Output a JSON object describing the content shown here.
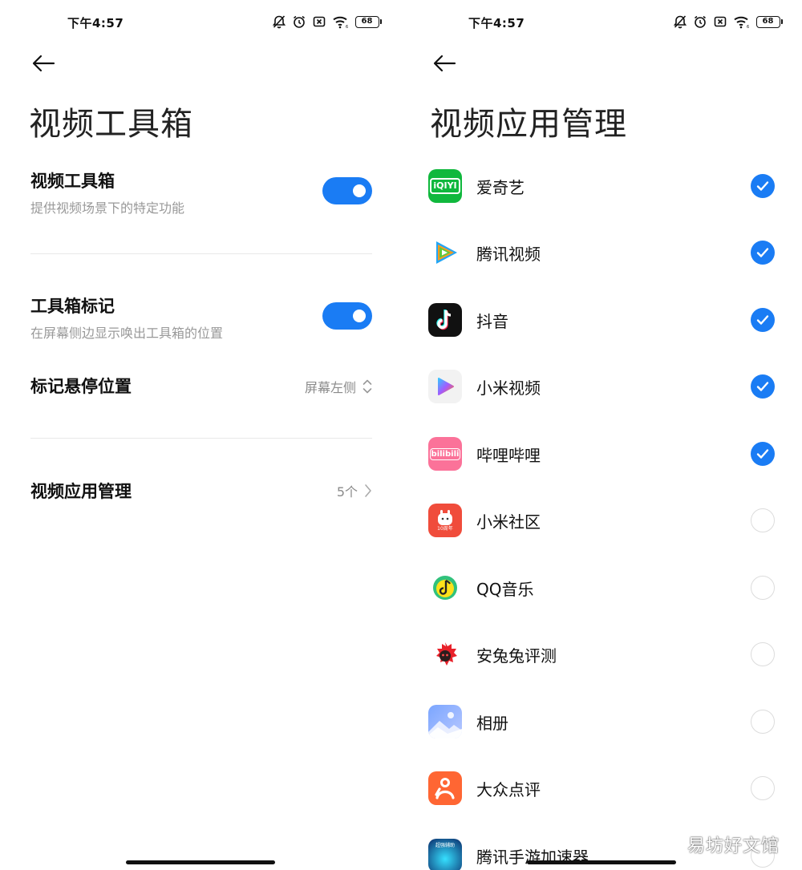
{
  "status_bar": {
    "time": "下午4:57",
    "battery": "68"
  },
  "left": {
    "title": "视频工具箱",
    "toolbox": {
      "title": "视频工具箱",
      "subtitle": "提供视频场景下的特定功能",
      "enabled": true
    },
    "marker": {
      "title": "工具箱标记",
      "subtitle": "在屏幕侧边显示唤出工具箱的位置",
      "enabled": true
    },
    "hover_position": {
      "title": "标记悬停位置",
      "value": "屏幕左侧"
    },
    "app_management": {
      "title": "视频应用管理",
      "value": "5个"
    }
  },
  "right": {
    "title": "视频应用管理",
    "apps": [
      {
        "name": "爱奇艺",
        "icon": "iqiyi-icon",
        "icon_text": "iQIYI",
        "checked": true
      },
      {
        "name": "腾讯视频",
        "icon": "tencent-video-icon",
        "checked": true
      },
      {
        "name": "抖音",
        "icon": "douyin-icon",
        "checked": true
      },
      {
        "name": "小米视频",
        "icon": "mi-video-icon",
        "checked": true
      },
      {
        "name": "哔哩哔哩",
        "icon": "bilibili-icon",
        "icon_text": "bilibili",
        "checked": true
      },
      {
        "name": "小米社区",
        "icon": "mi-community-icon",
        "icon_text": "10周年",
        "checked": false
      },
      {
        "name": "QQ音乐",
        "icon": "qq-music-icon",
        "checked": false
      },
      {
        "name": "安兔兔评测",
        "icon": "antutu-icon",
        "checked": false
      },
      {
        "name": "相册",
        "icon": "gallery-icon",
        "checked": false
      },
      {
        "name": "大众点评",
        "icon": "dianping-icon",
        "checked": false
      },
      {
        "name": "腾讯手游加速器",
        "icon": "game-accelerator-icon",
        "icon_text": "超强辅助",
        "checked": false
      }
    ]
  },
  "watermark": "易坊好文馆",
  "colors": {
    "accent": "#1a7cf4",
    "divider": "#e8e8e8",
    "subtext": "#999999"
  }
}
